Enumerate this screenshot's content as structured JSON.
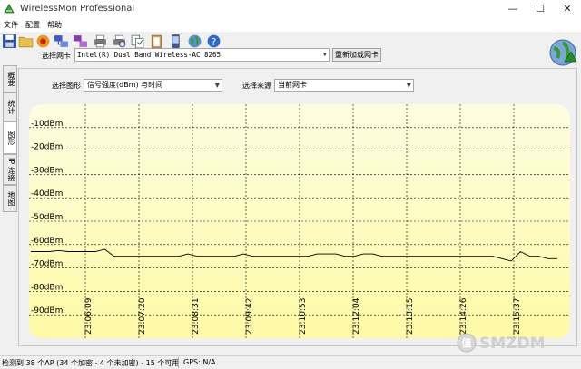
{
  "window": {
    "title": "WirelessMon Professional"
  },
  "menu": {
    "items": [
      "文件",
      "配置",
      "帮助"
    ]
  },
  "toolbar": {
    "buttons": [
      "save-icon",
      "open-folder-icon",
      "record-icon",
      "network-icon",
      "network-compare-icon",
      "printer-icon",
      "print-preview-icon",
      "copy-icon",
      "clipboard-icon",
      "phone-icon",
      "globe-icon",
      "globe-location-icon",
      "help-icon"
    ]
  },
  "adapter": {
    "label": "选择网卡",
    "value": "Intel(R) Dual Band Wireless-AC 8265",
    "reload_label": "重新加载网卡"
  },
  "side_tabs": [
    "概要",
    "统计",
    "图形",
    "IP 连接",
    "地图"
  ],
  "graph_controls": {
    "graph_label": "选择图形",
    "graph_value": "信号强度(dBm) 与时间",
    "source_label": "选择来源",
    "source_value": "当前网卡"
  },
  "chart_data": {
    "type": "line",
    "y_labels": [
      "-10dBm",
      "-20dBm",
      "-30dBm",
      "-40dBm",
      "-50dBm",
      "-60dBm",
      "-70dBm",
      "-80dBm",
      "-90dBm"
    ],
    "ylim": [
      0,
      -100
    ],
    "x_labels": [
      "23:06:09",
      "23:07:20",
      "23:08:31",
      "23:09:42",
      "23:10:53",
      "23:12:04",
      "23:13:15",
      "23:14:26",
      "23:15:37"
    ],
    "grid": true,
    "series": [
      {
        "values": [
          -63,
          -63,
          -63,
          -62.5,
          -63,
          -63,
          -63,
          -63,
          -62,
          -65,
          -65,
          -65,
          -65,
          -65,
          -65,
          -65,
          -65,
          -64,
          -65,
          -65,
          -65,
          -65,
          -65,
          -64,
          -65,
          -65,
          -65,
          -65,
          -65,
          -65,
          -65,
          -64,
          -64,
          -64,
          -65,
          -65,
          -64,
          -64,
          -65,
          -65,
          -65,
          -65,
          -65,
          -65,
          -65,
          -65,
          -65,
          -65,
          -65,
          -65,
          -65,
          -66,
          -67,
          -63,
          -65,
          -65,
          -66,
          -66
        ]
      }
    ],
    "colors": {
      "top": "#fdfde0",
      "bottom": "#fefaa6",
      "grid": "#000000",
      "line": "#000000"
    }
  },
  "status": {
    "text": "检测到 38 个AP (34 个加密 - 4 个未加密) - 15 个可用",
    "gps": "GPS: N/A"
  }
}
